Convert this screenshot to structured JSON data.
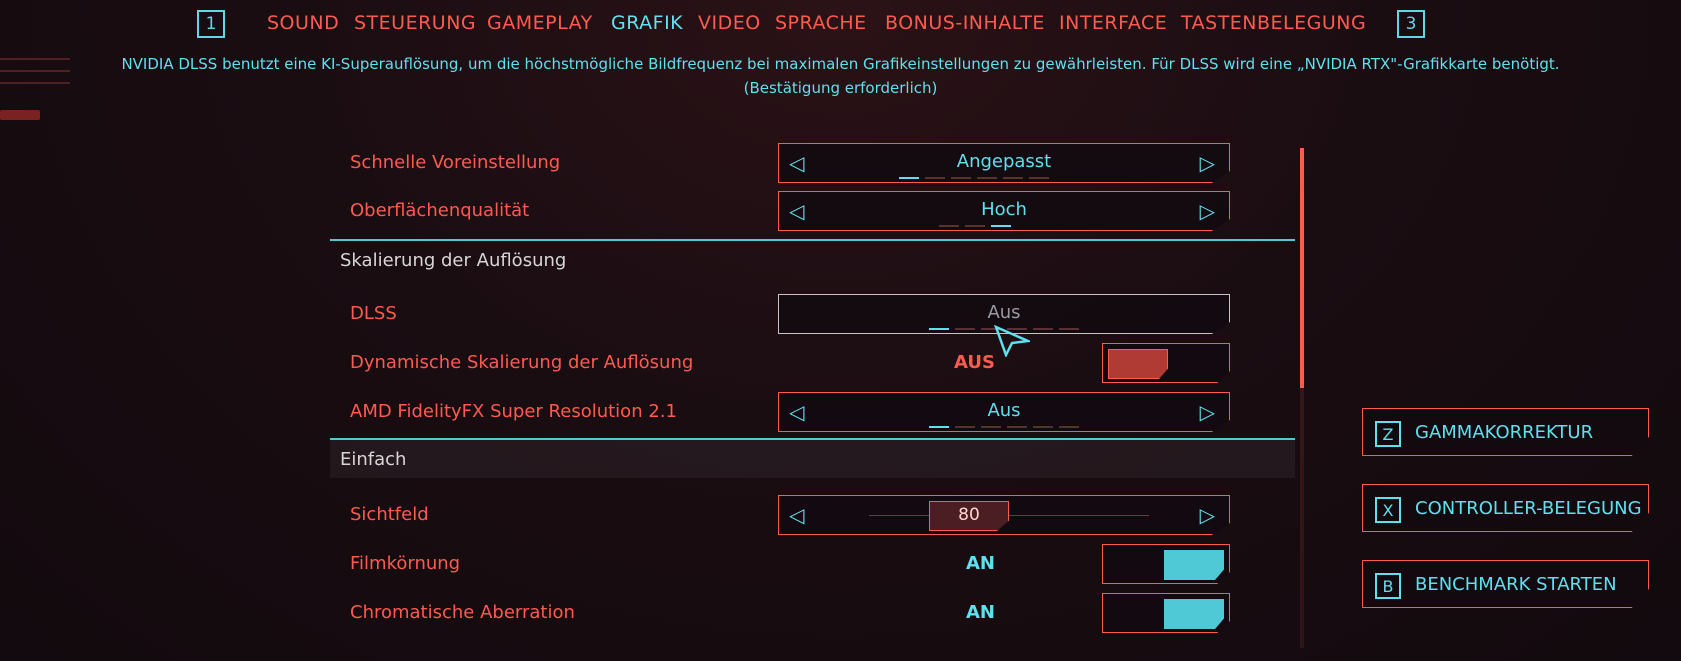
{
  "nav": {
    "prev_key": "1",
    "next_key": "3",
    "tabs": [
      "SOUND",
      "STEUERUNG",
      "GAMEPLAY",
      "GRAFIK",
      "VIDEO",
      "SPRACHE",
      "BONUS-INHALTE",
      "INTERFACE",
      "TASTENBELEGUNG"
    ],
    "active_tab": "GRAFIK"
  },
  "hint": {
    "line1": "NVIDIA DLSS benutzt eine KI-Superauflösung, um die höchstmögliche Bildfrequenz bei maximalen Grafikeinstellungen zu gewährleisten. Für DLSS wird eine „NVIDIA RTX\"-Grafikkarte benötigt.",
    "line2": "(Bestätigung erforderlich)"
  },
  "settings": {
    "quick_preset": {
      "label": "Schnelle Voreinstellung",
      "value": "Angepasst"
    },
    "texture_quality": {
      "label": "Oberflächenqualität",
      "value": "Hoch"
    },
    "section_scaling": "Skalierung der Auflösung",
    "dlss": {
      "label": "DLSS",
      "value": "Aus"
    },
    "dynamic_scaling": {
      "label": "Dynamische Skalierung der Auflösung",
      "value": "AUS"
    },
    "fsr": {
      "label": "AMD FidelityFX Super Resolution 2.1",
      "value": "Aus"
    },
    "section_basic": "Einfach",
    "fov": {
      "label": "Sichtfeld",
      "value": "80"
    },
    "film_grain": {
      "label": "Filmkörnung",
      "value": "AN"
    },
    "chromatic_aberration": {
      "label": "Chromatische Aberration",
      "value": "AN"
    }
  },
  "side_buttons": {
    "gamma": {
      "key": "Z",
      "label": "GAMMAKORREKTUR"
    },
    "controller": {
      "key": "X",
      "label": "CONTROLLER-BELEGUNG"
    },
    "benchmark": {
      "key": "B",
      "label": "BENCHMARK STARTEN"
    }
  },
  "colors": {
    "accent_red": "#ff5a4f",
    "accent_cyan": "#5fe0ee",
    "background": "#1a0d12"
  }
}
